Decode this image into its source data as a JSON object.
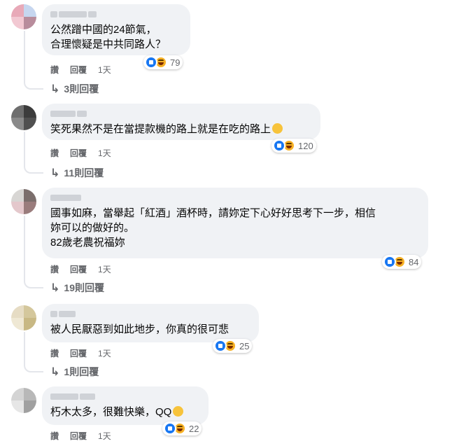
{
  "comments": [
    {
      "text": "公然蹭中國的24節氣，\n合理懷疑是中共同路人？",
      "reaction_count": "79",
      "like_label": "讚",
      "reply_label": "回覆",
      "time": "1天",
      "replies_label": "3則回覆",
      "avatar_colors": [
        "#e8a9b8",
        "#c6d6ef",
        "#f2c8d2",
        "#b88c9c"
      ]
    },
    {
      "text": "笑死果然不是在當提款機的路上就是在吃的路上",
      "reaction_count": "120",
      "like_label": "讚",
      "reply_label": "回覆",
      "time": "1天",
      "replies_label": "11則回覆",
      "avatar_colors": [
        "#6e6e6e",
        "#3c3c3c",
        "#8a8a8a",
        "#505050"
      ]
    },
    {
      "text": "國事如麻，當舉起「紅酒」酒杯時，請妳定下心好好思考下一步，相信\n妳可以的做好的。\n82歲老農祝福妳",
      "reaction_count": "84",
      "like_label": "讚",
      "reply_label": "回覆",
      "time": "1天",
      "replies_label": "19則回覆",
      "avatar_colors": [
        "#d8d6d4",
        "#7b6e6c",
        "#e4c8cc",
        "#9a7c7c"
      ]
    },
    {
      "text": "被人民厭惡到如此地步，你真的很可悲",
      "reaction_count": "25",
      "like_label": "讚",
      "reply_label": "回覆",
      "time": "1天",
      "replies_label": "1則回覆",
      "avatar_colors": [
        "#e6dcc4",
        "#d4c79c",
        "#efe8d4",
        "#c8b884"
      ]
    },
    {
      "text": "朽木太多，很難快樂，QQ",
      "reaction_count": "22",
      "like_label": "讚",
      "reply_label": "回覆",
      "time": "1天",
      "avatar_colors": [
        "#d4d4d4",
        "#b8b8b8",
        "#e6e6e6",
        "#a0a0a0"
      ]
    }
  ],
  "colors": {
    "bubble": "#f0f2f5",
    "meta_text": "#65676b",
    "like_blue": "#1877f2",
    "haha_yellow": "#f7b125"
  },
  "icons": {
    "like": "thumbs-up-reaction",
    "haha": "laughing-reaction",
    "reply_arrow": "reply-arrow-icon"
  }
}
